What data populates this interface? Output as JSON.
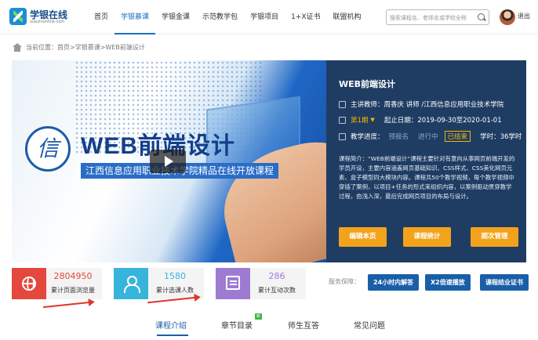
{
  "brand": {
    "name": "学银在线",
    "subtitle": "xueyinonline.com"
  },
  "nav": {
    "items": [
      {
        "label": "首页"
      },
      {
        "label": "学银慕课",
        "active": true
      },
      {
        "label": "学银金课"
      },
      {
        "label": "示范教学包"
      },
      {
        "label": "学银项目"
      },
      {
        "label": "1+X证书"
      },
      {
        "label": "联盟机构"
      }
    ]
  },
  "search": {
    "placeholder": "搜索课程名、老师名或学校全称",
    "value": ""
  },
  "user": {
    "logout_label": "退出"
  },
  "breadcrumb": {
    "prefix": "当前位置：",
    "items": [
      "首页",
      "学银慕课",
      "WEB前端设计"
    ],
    "separator": " > "
  },
  "banner": {
    "title": "WEB前端设计",
    "subtitle": "江西信息应用职业技术学院精品在线开放课程"
  },
  "course": {
    "title": "WEB前端设计",
    "teacher_label": "主讲教师：",
    "teacher": "周香庆 讲师 /江西信息应用职业技术学院",
    "term": "第1期",
    "date_label": "起止日期：",
    "dates": "2019-09-30至2020-01-01",
    "progress_label": "教学进度：",
    "progress_states": [
      "预报名",
      "进行中",
      "已结束"
    ],
    "current_state": "已结束",
    "hours_label": "学时：",
    "hours": "36学时",
    "description": "课程简介：“WEB前端设计”课程主要针对有意向从事网页前端开发的学员开设，主要内容涵盖网页基础知识、CSS样式、CSS美化网页元素、盒子模型四大模块内容。课程共50个教学视频，每个教学视频中穿插了案例，以项目+任务的形式来组织内容，以案例驱动贯穿教学过程，由浅入深，最后完成网页项目的布局与设计。"
  },
  "actions": {
    "edit": "编辑本页",
    "stats": "课程统计",
    "terms": "期次管理"
  },
  "stats": [
    {
      "value": "2804950",
      "label": "累计页面浏览量",
      "icon": "globe-icon",
      "color": "#e4473d"
    },
    {
      "value": "1580",
      "label": "累计选课人数",
      "icon": "user-icon",
      "color": "#37b4dc"
    },
    {
      "value": "286",
      "label": "累计互动次数",
      "icon": "chat-icon",
      "color": "#9d7bd3"
    }
  ],
  "guarantee": {
    "label": "服务保障：",
    "items": [
      "24小时内解答",
      "X2倍速播放",
      "课程结业证书"
    ]
  },
  "tabs": {
    "items": [
      "课程介绍",
      "章节目录",
      "师生互答",
      "常见问题"
    ],
    "active": "课程介绍",
    "badge": "新"
  },
  "colors": {
    "accent": "#1a5ea8",
    "info_panel": "#1f3d63",
    "action": "#f3a31b"
  }
}
